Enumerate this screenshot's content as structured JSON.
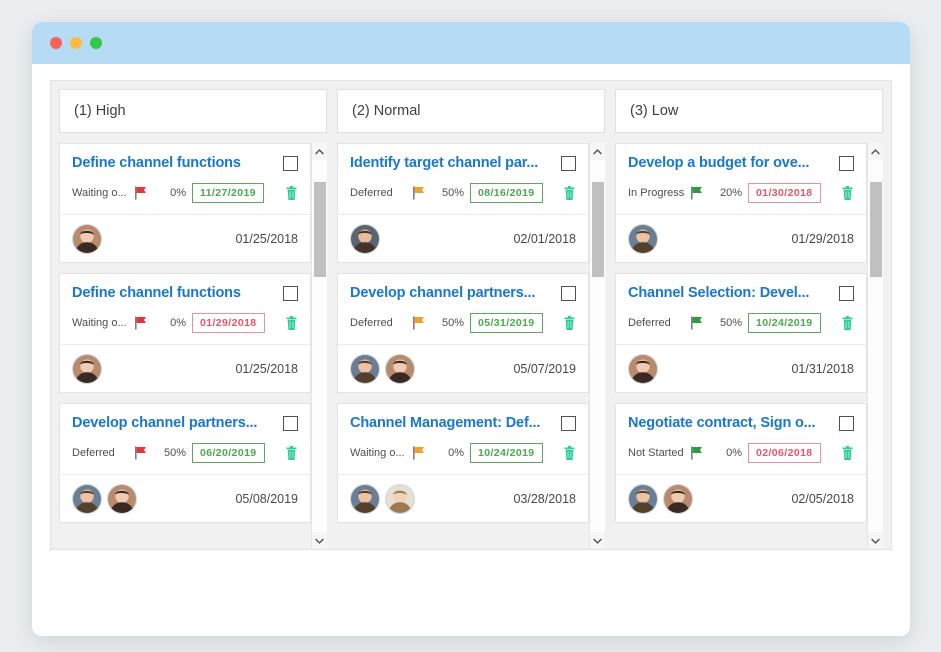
{
  "window": {
    "titlebar_buttons": [
      "close-button",
      "minimize-button",
      "maximize-button"
    ]
  },
  "board": {
    "columns": [
      {
        "header": "(1) High",
        "scroll": {
          "up": "▲",
          "down": "▼",
          "thumb_top_pct": 5,
          "thumb_height_pct": 30
        },
        "cards": [
          {
            "title": "Define channel functions",
            "status": "Waiting o...",
            "flag_color": "#e8323c",
            "progress": "0%",
            "due_date": "11/27/2019",
            "due_state": "green",
            "created_date": "01/25/2018",
            "avatars": [
              "avatar-woman-dark-hair"
            ]
          },
          {
            "title": "Define channel functions",
            "status": "Waiting o...",
            "flag_color": "#e8323c",
            "progress": "0%",
            "due_date": "01/29/2018",
            "due_state": "red",
            "created_date": "01/25/2018",
            "avatars": [
              "avatar-woman-dark-hair"
            ]
          },
          {
            "title": "Develop channel partners...",
            "status": "Deferred",
            "flag_color": "#e8323c",
            "progress": "50%",
            "due_date": "06/20/2019",
            "due_state": "green",
            "created_date": "05/08/2019",
            "avatars": [
              "avatar-man-beard",
              "avatar-woman-dark-hair"
            ]
          }
        ]
      },
      {
        "header": "(2) Normal",
        "scroll": {
          "up": "▲",
          "down": "▼",
          "thumb_top_pct": 5,
          "thumb_height_pct": 30
        },
        "cards": [
          {
            "title": "Identify target channel par...",
            "status": "Deferred",
            "flag_color": "#f0a32a",
            "progress": "50%",
            "due_date": "08/16/2019",
            "due_state": "green",
            "created_date": "02/01/2018",
            "avatars": [
              "avatar-man-camera"
            ]
          },
          {
            "title": "Develop channel partners...",
            "status": "Deferred",
            "flag_color": "#f0a32a",
            "progress": "50%",
            "due_date": "05/31/2019",
            "due_state": "green",
            "created_date": "05/07/2019",
            "avatars": [
              "avatar-man-beard",
              "avatar-woman-dark-hair"
            ]
          },
          {
            "title": "Channel Management: Def...",
            "status": "Waiting o...",
            "flag_color": "#f0a32a",
            "progress": "0%",
            "due_date": "10/24/2019",
            "due_state": "green",
            "created_date": "03/28/2018",
            "avatars": [
              "avatar-man-beard",
              "avatar-man-glasses"
            ]
          }
        ]
      },
      {
        "header": "(3) Low",
        "scroll": {
          "up": "▲",
          "down": "▼",
          "thumb_top_pct": 5,
          "thumb_height_pct": 30
        },
        "cards": [
          {
            "title": "Develop a budget for ove...",
            "status": "In Progress",
            "flag_color": "#2e9b3f",
            "progress": "20%",
            "due_date": "01/30/2018",
            "due_state": "red",
            "created_date": "01/29/2018",
            "avatars": [
              "avatar-man-beard"
            ]
          },
          {
            "title": "Channel Selection: Devel...",
            "status": "Deferred",
            "flag_color": "#2e9b3f",
            "progress": "50%",
            "due_date": "10/24/2019",
            "due_state": "green",
            "created_date": "01/31/2018",
            "avatars": [
              "avatar-woman-dark-hair"
            ]
          },
          {
            "title": "Negotiate contract, Sign o...",
            "status": "Not Started",
            "flag_color": "#2e9b3f",
            "progress": "0%",
            "due_date": "02/06/2018",
            "due_state": "red",
            "created_date": "02/05/2018",
            "avatars": [
              "avatar-man-beard",
              "avatar-woman-dark-hair"
            ]
          }
        ]
      }
    ]
  },
  "colors": {
    "title_blue": "#1877cf",
    "titlebar_blue": "#b6dbf5",
    "trash_teal": "#2ecc9a",
    "due_green": "#4aa84f",
    "due_red": "#e8546a",
    "page_bg": "#eaeef0"
  }
}
